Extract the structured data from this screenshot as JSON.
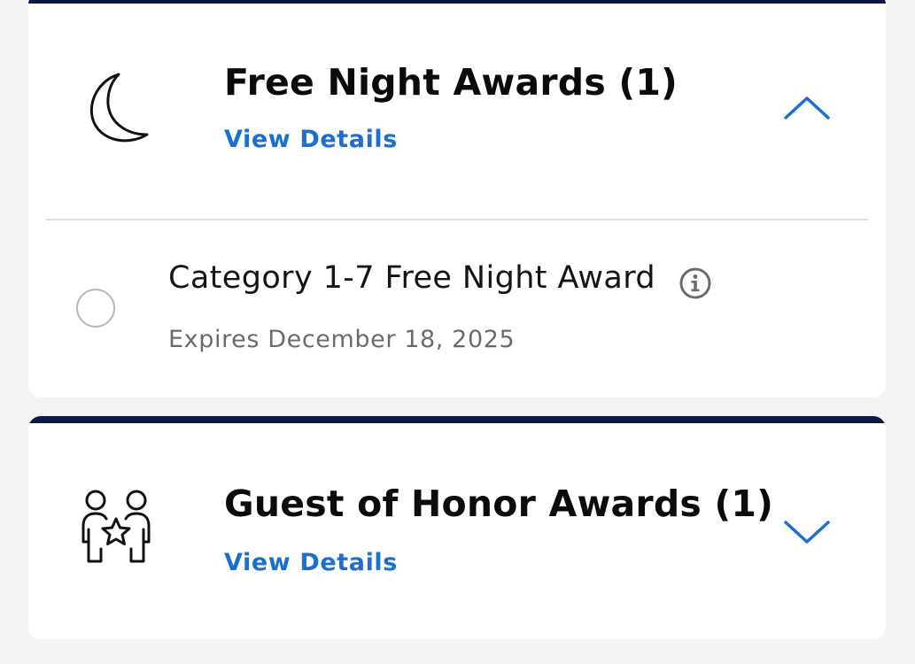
{
  "sections": [
    {
      "title": "Free Night Awards (1)",
      "link": "View Details",
      "icon": "moon-icon",
      "chevron": "chevron-up-icon",
      "items": [
        {
          "name": "Category 1-7 Free Night Award",
          "expiry": "Expires December 18, 2025",
          "selected": false
        }
      ]
    },
    {
      "title": "Guest of Honor Awards (1)",
      "link": "View Details",
      "icon": "guests-star-icon",
      "chevron": "chevron-down-icon"
    }
  ],
  "colors": {
    "accent_bar": "#0c1744",
    "link": "#1a6fd1",
    "background": "#f4f4f5"
  }
}
